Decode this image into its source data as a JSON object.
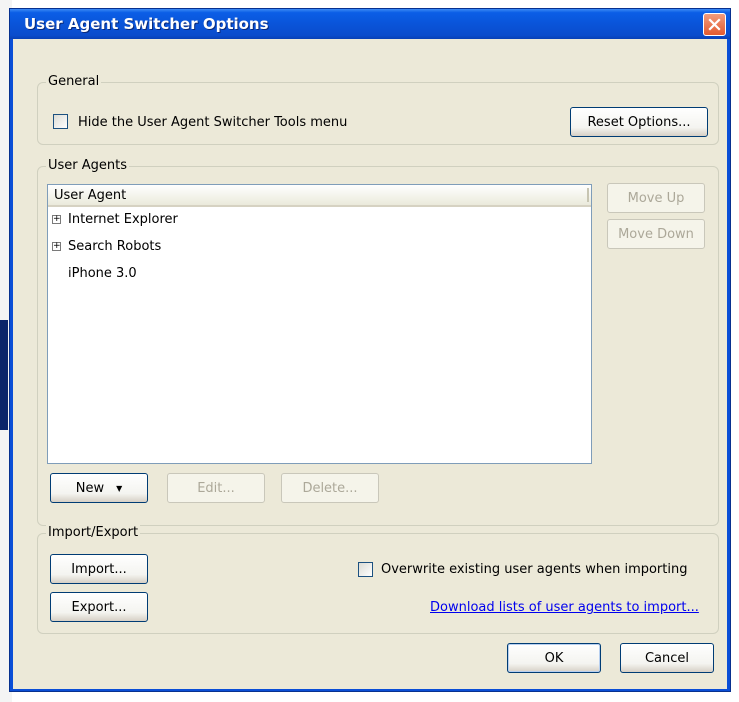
{
  "window": {
    "title": "User Agent Switcher Options"
  },
  "general": {
    "group_label": "General",
    "hide_menu_label": "Hide the User Agent Switcher Tools menu",
    "hide_menu_checked": false,
    "reset_button": "Reset Options..."
  },
  "user_agents": {
    "group_label": "User Agents",
    "column_header": "User Agent",
    "items": [
      {
        "label": "Internet Explorer",
        "expandable": true,
        "expander_glyph": "+"
      },
      {
        "label": "Search Robots",
        "expandable": true,
        "expander_glyph": "+"
      },
      {
        "label": "iPhone 3.0",
        "expandable": false
      }
    ],
    "move_up_button": "Move Up",
    "move_down_button": "Move Down",
    "new_button": "New",
    "new_arrow": "▼",
    "edit_button": "Edit...",
    "delete_button": "Delete..."
  },
  "import_export": {
    "group_label": "Import/Export",
    "import_button": "Import...",
    "export_button": "Export...",
    "overwrite_label": "Overwrite existing user agents when importing",
    "overwrite_checked": false,
    "download_link": "Download lists of user agents to import..."
  },
  "footer": {
    "ok_button": "OK",
    "cancel_button": "Cancel"
  },
  "colors": {
    "titlebar": "#0a54d9",
    "dialog_face": "#ece9d8",
    "link": "#0000ee",
    "disabled_text": "#aca899"
  }
}
